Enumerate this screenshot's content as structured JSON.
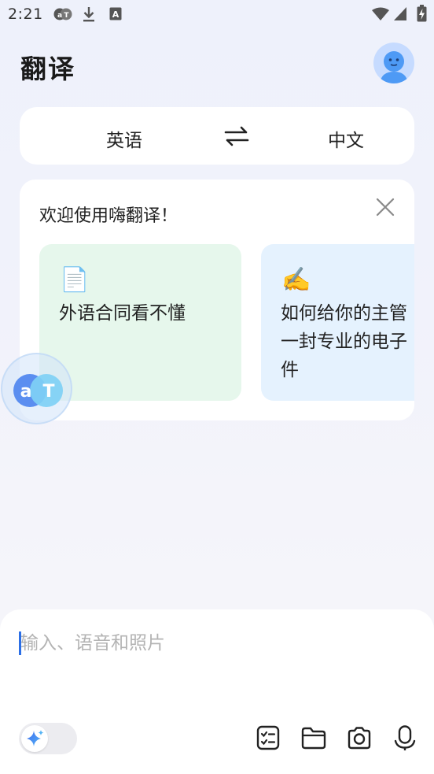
{
  "status_bar": {
    "time": "2:21"
  },
  "header": {
    "title": "翻译"
  },
  "language_bar": {
    "source": "英语",
    "target": "中文"
  },
  "welcome": {
    "title": "欢迎使用嗨翻译！",
    "suggestions": [
      {
        "emoji": "📄",
        "text": "外语合同看不懂"
      },
      {
        "emoji": "✍️",
        "text": "如何给你的主管一封专业的电子件"
      }
    ]
  },
  "input": {
    "placeholder": "输入、语音和照片",
    "value": ""
  },
  "colors": {
    "accent": "#2c6fe6",
    "suggestion_green": "#e6f7ec",
    "suggestion_blue": "#e5f2fe",
    "avatar": "#c6dbff"
  },
  "icons": {
    "status": [
      "translate-badge-icon",
      "download-icon",
      "font-a-icon",
      "wifi-icon",
      "signal-icon",
      "battery-charging-icon"
    ],
    "tools": [
      "checklist-icon",
      "folder-icon",
      "camera-icon",
      "microphone-icon"
    ],
    "ai": "sparkle-icon"
  }
}
